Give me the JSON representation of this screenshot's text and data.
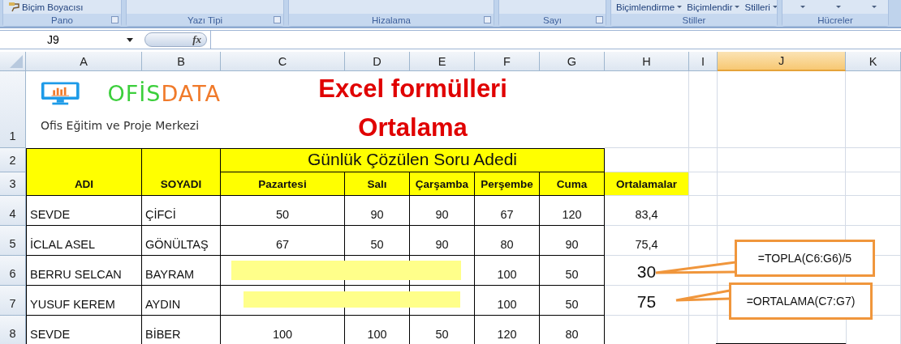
{
  "ribbon": {
    "groups": [
      {
        "label": "Pano",
        "launcher": true,
        "items": [
          {
            "text": "Biçim Boyacısı",
            "kind": "tool"
          }
        ]
      },
      {
        "label": "Yazı Tipi",
        "launcher": true
      },
      {
        "label": "Hizalama",
        "launcher": true
      },
      {
        "label": "Sayı",
        "launcher": true
      },
      {
        "label": "Stiller",
        "launcher": false,
        "items": [
          {
            "text": "Biçimlendirme",
            "kind": "menu"
          },
          {
            "text": "Biçimlendir",
            "kind": "menu"
          },
          {
            "text": "Stilleri",
            "kind": "menu"
          }
        ]
      },
      {
        "label": "Hücreler",
        "launcher": false,
        "items": [
          {
            "kind": "menu"
          },
          {
            "kind": "menu"
          },
          {
            "kind": "menu"
          }
        ]
      }
    ]
  },
  "formula_bar": {
    "name_box": "J9",
    "function_button": "fx"
  },
  "columns": [
    {
      "label": "A",
      "selected": false
    },
    {
      "label": "B",
      "selected": false
    },
    {
      "label": "C",
      "selected": false
    },
    {
      "label": "D",
      "selected": false
    },
    {
      "label": "E",
      "selected": false
    },
    {
      "label": "F",
      "selected": false
    },
    {
      "label": "G",
      "selected": false
    },
    {
      "label": "H",
      "selected": false
    },
    {
      "label": "I",
      "selected": false
    },
    {
      "label": "J",
      "selected": true
    },
    {
      "label": "K",
      "selected": false
    }
  ],
  "rows": [
    {
      "label": "1",
      "selected": false
    },
    {
      "label": "2",
      "selected": false
    },
    {
      "label": "3",
      "selected": false
    },
    {
      "label": "4",
      "selected": false
    },
    {
      "label": "5",
      "selected": false
    },
    {
      "label": "6",
      "selected": false
    },
    {
      "label": "7",
      "selected": false
    },
    {
      "label": "8",
      "selected": false
    }
  ],
  "sheet": {
    "logo": {
      "wordmark": [
        "OFİS",
        "DATA"
      ],
      "tagline": "Ofis Eğitim ve Proje Merkezi"
    },
    "title": [
      "Excel formülleri",
      "Ortalama"
    ],
    "group_header": "Günlük Çözülen Soru Adedi",
    "headers": [
      "ADI",
      "SOYADI",
      "Pazartesi",
      "Salı",
      "Çarşamba",
      "Perşembe",
      "Cuma",
      "Ortalamalar"
    ],
    "records": [
      {
        "first_name": "SEVDE",
        "last_name": "ÇİFCİ",
        "days": {
          "monday": "50",
          "tuesday": "90",
          "wednesday": "90",
          "thursday": "67",
          "friday": "120"
        },
        "average": "83,4",
        "highlighted": false,
        "emphasized": false
      },
      {
        "first_name": "İCLAL ASEL",
        "last_name": "GÖNÜLTAŞ",
        "days": {
          "monday": "67",
          "tuesday": "50",
          "wednesday": "90",
          "thursday": "80",
          "friday": "90"
        },
        "average": "75,4",
        "highlighted": false,
        "emphasized": false
      },
      {
        "first_name": "BERRU SELCAN",
        "last_name": "BAYRAM",
        "days": {
          "thursday": "100",
          "friday": "50"
        },
        "average": "30",
        "highlighted": true,
        "emphasized": true
      },
      {
        "first_name": "YUSUF KEREM",
        "last_name": "AYDIN",
        "days": {
          "thursday": "100",
          "friday": "50"
        },
        "average": "75",
        "highlighted": true,
        "emphasized": true
      },
      {
        "first_name": "SEVDE",
        "last_name": "BİBER",
        "days": {
          "monday": "100",
          "tuesday": "100",
          "wednesday": "50",
          "thursday": "120",
          "friday": "80"
        },
        "highlighted": false
      }
    ],
    "callouts": [
      {
        "text": "=TOPLA(C6:G6)/5"
      },
      {
        "text": "=ORTALAMA(C7:G7)"
      }
    ]
  }
}
